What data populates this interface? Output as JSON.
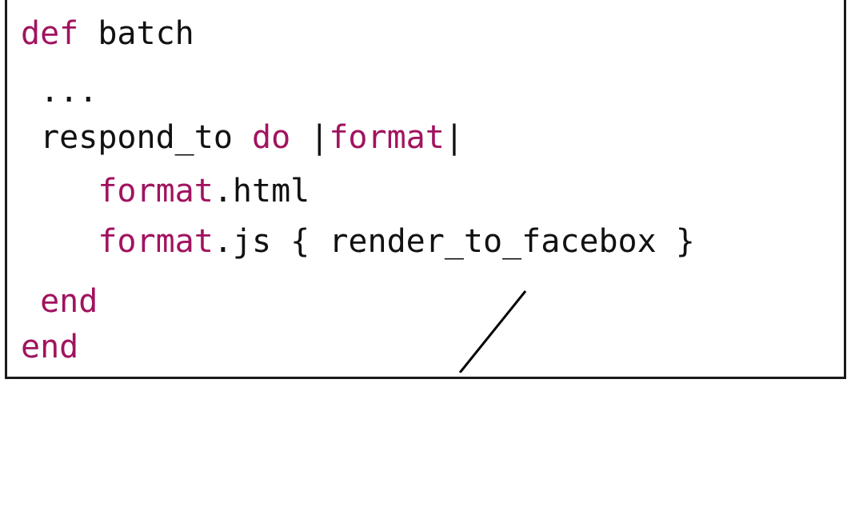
{
  "code": {
    "line1": {
      "kw": "def",
      "rest": " batch"
    },
    "line2": {
      "text": " ..."
    },
    "line3": {
      "a": " respond_to ",
      "kw1": "do",
      "b": " |",
      "kw2": "format",
      "c": "|"
    },
    "line4": {
      "indent": "    ",
      "kw": "format",
      "rest": ".html"
    },
    "line5": {
      "indent": "    ",
      "kw": "format",
      "rest": ".js { render_to_facebox }"
    },
    "line6": {
      "indent": " ",
      "kw": "end"
    },
    "line7": {
      "kw": "end"
    }
  },
  "colors": {
    "keyword": "#a1135f",
    "text": "#111111",
    "border": "#1a1a1a",
    "line": "#000000"
  }
}
